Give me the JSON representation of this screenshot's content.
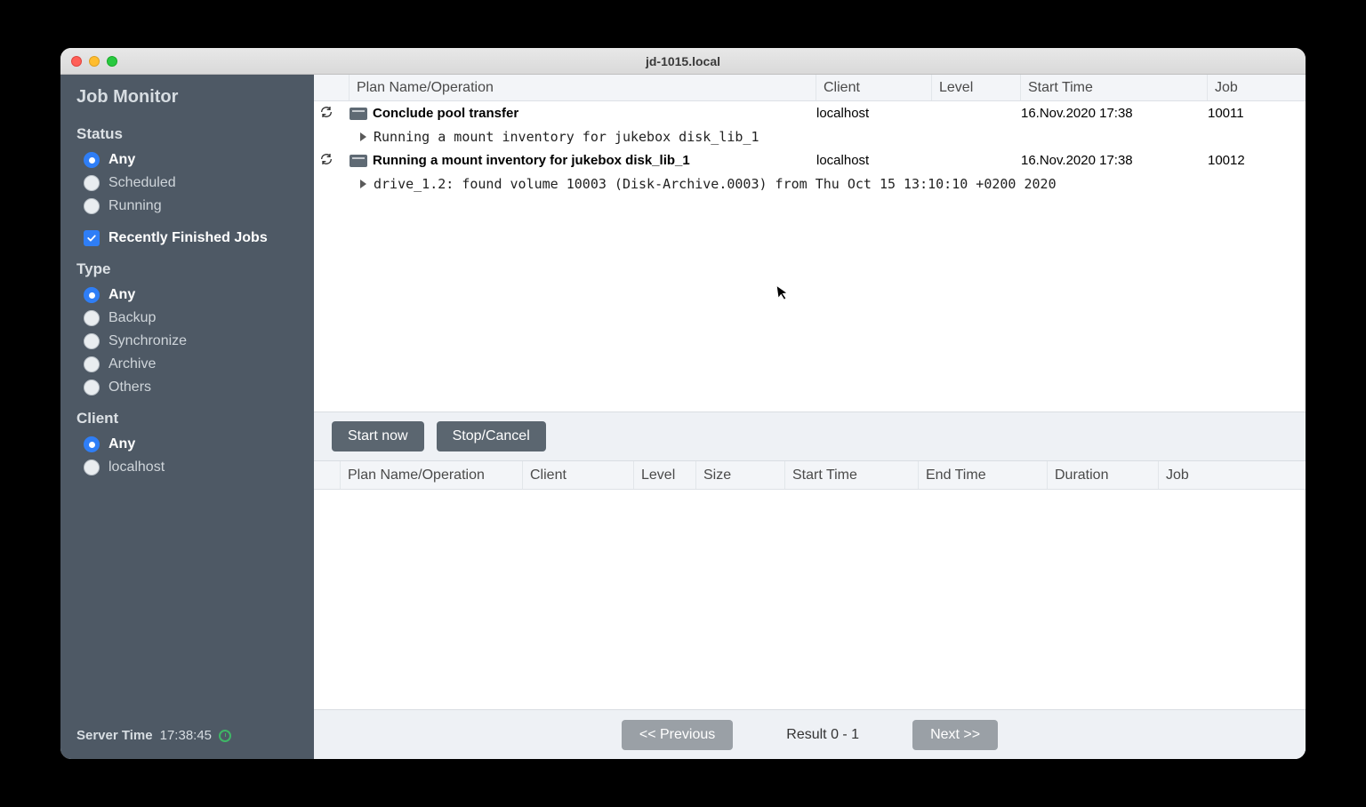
{
  "window": {
    "title": "jd-1015.local"
  },
  "sidebar": {
    "heading": "Job Monitor",
    "status": {
      "label": "Status",
      "options": [
        "Any",
        "Scheduled",
        "Running"
      ],
      "selected": "Any",
      "recent_label": "Recently Finished Jobs",
      "recent_checked": true
    },
    "type": {
      "label": "Type",
      "options": [
        "Any",
        "Backup",
        "Synchronize",
        "Archive",
        "Others"
      ],
      "selected": "Any"
    },
    "client": {
      "label": "Client",
      "options": [
        "Any",
        "localhost"
      ],
      "selected": "Any"
    },
    "server_time": {
      "label": "Server Time",
      "value": "17:38:45"
    }
  },
  "upper_table": {
    "headers": {
      "plan": "Plan Name/Operation",
      "client": "Client",
      "level": "Level",
      "start": "Start Time",
      "job": "Job"
    },
    "rows": [
      {
        "plan": "Conclude pool transfer",
        "client": "localhost",
        "level": "",
        "start": "16.Nov.2020 17:38",
        "job": "10011",
        "detail": "Running a mount inventory for jukebox disk_lib_1"
      },
      {
        "plan": "Running a mount inventory for jukebox disk_lib_1",
        "client": "localhost",
        "level": "",
        "start": "16.Nov.2020 17:38",
        "job": "10012",
        "detail": "drive_1.2: found volume 10003 (Disk-Archive.0003) from Thu Oct 15 13:10:10 +0200 2020"
      }
    ]
  },
  "toolbar": {
    "start": "Start now",
    "stop": "Stop/Cancel"
  },
  "lower_table": {
    "headers": {
      "plan": "Plan Name/Operation",
      "client": "Client",
      "level": "Level",
      "size": "Size",
      "start": "Start Time",
      "end": "End Time",
      "dur": "Duration",
      "job": "Job"
    }
  },
  "footer": {
    "prev": "<< Previous",
    "result": "Result 0 - 1",
    "next": "Next >>"
  }
}
